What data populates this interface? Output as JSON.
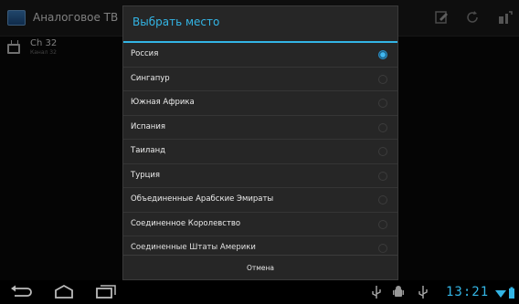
{
  "app": {
    "title": "Аналоговое ТВ",
    "channel_name": "Ch 32",
    "channel_sub": "Канал 32"
  },
  "dialog": {
    "title": "Выбрать место",
    "items": [
      {
        "label": "Россия",
        "checked": true
      },
      {
        "label": "Сингапур",
        "checked": false
      },
      {
        "label": "Южная Африка",
        "checked": false
      },
      {
        "label": "Испания",
        "checked": false
      },
      {
        "label": "Таиланд",
        "checked": false
      },
      {
        "label": "Турция",
        "checked": false
      },
      {
        "label": "Объединенные Арабские Эмираты",
        "checked": false
      },
      {
        "label": "Соединенное Королевство",
        "checked": false
      },
      {
        "label": "Соединенные Штаты Америки",
        "checked": false
      }
    ],
    "cancel_label": "Отмена"
  },
  "status": {
    "time": "13:21"
  },
  "colors": {
    "accent": "#33b5e5"
  }
}
